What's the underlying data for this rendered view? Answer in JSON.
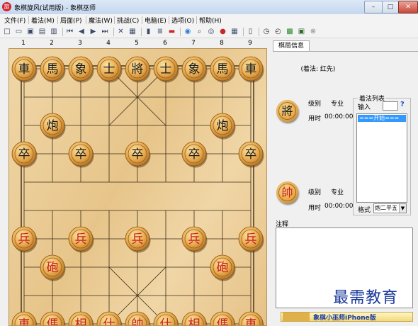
{
  "window": {
    "title": "象棋旋风(试用版) - 象棋巫师",
    "logo_text": "旋",
    "min_symbol": "–",
    "max_symbol": "□",
    "close_symbol": "✕"
  },
  "menu": [
    "文件(F)",
    "着法(M)",
    "局面(P)",
    "魔法(W)",
    "挑战(C)",
    "电脑(E)",
    "选项(O)",
    "帮助(H)"
  ],
  "toolbar_icons": [
    "new-icon",
    "open-icon",
    "save-icon",
    "print-icon",
    "copy-icon",
    "sep",
    "first-icon",
    "prev-icon",
    "next-icon",
    "last-icon",
    "sep",
    "cancel-icon",
    "library-icon",
    "sep",
    "book-icon",
    "tree-icon",
    "score-icon",
    "sep",
    "globe-icon",
    "search-icon",
    "eye-icon",
    "record-icon",
    "board-icon",
    "sep",
    "help-book-icon",
    "sep",
    "timer-icon",
    "clock-icon",
    "chart-icon",
    "screen-icon",
    "stop-icon"
  ],
  "board": {
    "column_numbers": [
      "1",
      "2",
      "3",
      "4",
      "5",
      "6",
      "7",
      "8",
      "9"
    ],
    "black_back_row": [
      "車",
      "馬",
      "象",
      "士",
      "將",
      "士",
      "象",
      "馬",
      "車"
    ],
    "black_cannon": "炮",
    "black_pawn": "卒",
    "red_pawn": "兵",
    "red_cannon": "砲",
    "red_back_row": [
      "車",
      "傌",
      "相",
      "仕",
      "帥",
      "仕",
      "相",
      "傌",
      "車"
    ],
    "colors": {
      "black_text": "#1a1a1a",
      "red_text": "#c81e1e",
      "board": "#ecd09c"
    }
  },
  "panel": {
    "tab": "棋局信息",
    "turn_status": "(着法: 红先)",
    "black_player": {
      "piece": "將",
      "level_label": "级别",
      "level_value": "专业",
      "time_label": "用时",
      "time_value": "00:00:00"
    },
    "red_player": {
      "piece": "帥",
      "level_label": "级别",
      "level_value": "专业",
      "time_label": "用时",
      "time_value": "00:00:00"
    },
    "moves": {
      "group_label": "着法列表",
      "input_label": "输入",
      "help_symbol": "?",
      "list": [
        "===开始==="
      ],
      "format_label": "格式",
      "format_value": "炮二平五"
    },
    "notes_label": "注释",
    "watermark": "最需教育",
    "banner": "象棋小巫师iPhone版"
  }
}
